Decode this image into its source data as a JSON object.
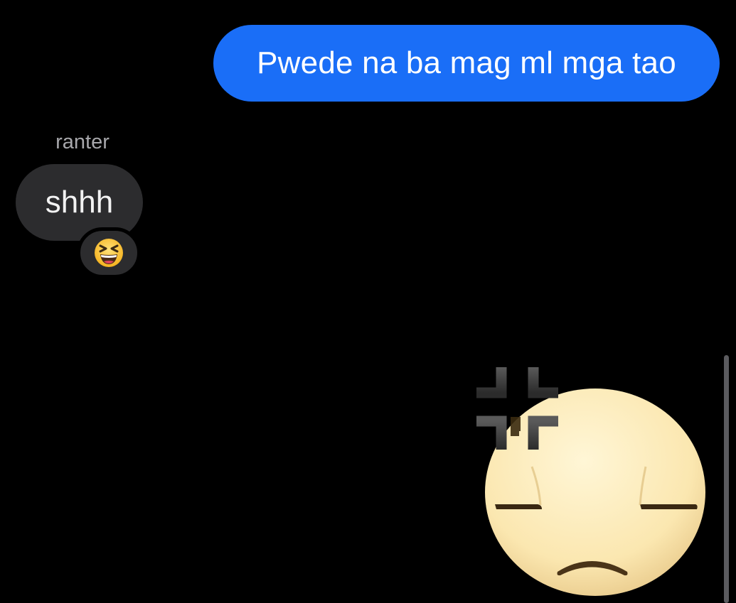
{
  "conversation": {
    "outgoing_message": "Pwede na ba mag ml mga tao",
    "incoming_sender": "ranter",
    "incoming_message": "shhh",
    "reaction_icon": "grinning-squinting-face-icon",
    "sticker_icon": "annoyed-face-with-anger-symbol-icon"
  },
  "colors": {
    "background": "#000000",
    "outgoing_bubble": "#1a6ef7",
    "incoming_bubble": "#2c2c2e",
    "sender_name": "#a7a7ab"
  }
}
